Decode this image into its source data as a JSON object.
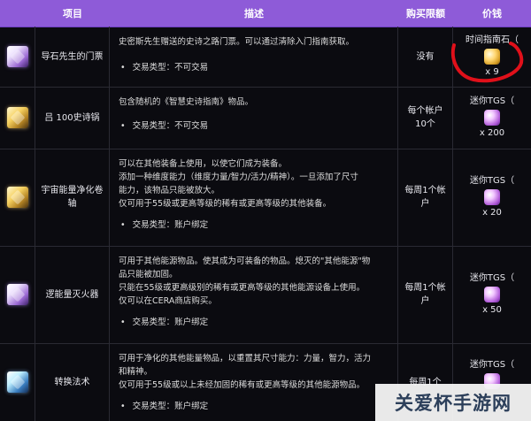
{
  "header": {
    "item": "项目",
    "description": "描述",
    "purchase_limit": "购买限额",
    "price": "价钱"
  },
  "rows": [
    {
      "icon": "magic-scroll-icon",
      "name": "导石先生的门票",
      "desc": [
        "史密斯先生赠送的史诗之路门票。可以通过清除入门指南获取。"
      ],
      "bullet": "交易类型：不可交易",
      "limit": "没有",
      "currency": "时间指南石（",
      "currency_icon": "time-guide-stone-icon",
      "qty": "x 9"
    },
    {
      "icon": "book-icon",
      "name": "吕 100史诗锅",
      "desc": [
        "包含随机的《智慧史诗指南》物品。"
      ],
      "bullet": "交易类型：不可交易",
      "limit": "每个帐户10个",
      "currency": "迷你TGS（",
      "currency_icon": "mini-tgs-icon",
      "qty": "x 200"
    },
    {
      "icon": "cosmic-scroll-icon",
      "name": "宇宙能量净化卷轴",
      "desc": [
        "可以在其他装备上使用，以使它们成为装备。",
        "添加一种维度能力（维度力量/智力/活力/精神）。一旦添加了尺寸",
        "能力，该物品只能被放大。",
        "仅可用于55级或更高等级的稀有或更高等级的其他装备。"
      ],
      "bullet": "交易类型：账户绑定",
      "limit": "每周1个帐户",
      "currency": "迷你TGS（",
      "currency_icon": "mini-tgs-icon",
      "qty": "x 20"
    },
    {
      "icon": "energy-extinguisher-icon",
      "name": "逻能量灭火器",
      "desc": [
        "可用于其他能源物品。使其成为可装备的物品。熄灭的\"其他能源\"物",
        "品只能被加固。",
        "只能在55级或更高级别的稀有或更高等级的其他能源设备上使用。",
        "仅可以在CERA商店购买。"
      ],
      "bullet": "交易类型：账户绑定",
      "limit": "每周1个帐户",
      "currency": "迷你TGS（",
      "currency_icon": "mini-tgs-icon",
      "qty": "x 50"
    },
    {
      "icon": "conversion-icon",
      "name": "转换法术",
      "desc": [
        "可用于净化的其他能量物品，以重置其尺寸能力：力量，智力，活力",
        "和精神。",
        "仅可用于55级或以上未经加固的稀有或更高等级的其他能源物品。"
      ],
      "bullet": "交易类型：账户绑定",
      "limit": "每周1个",
      "currency": "迷你TGS（",
      "currency_icon": "mini-tgs-icon",
      "qty": ""
    }
  ],
  "watermark": "关爱杯手游网",
  "colors": {
    "header": "#8e5bd8",
    "annotation": "#e0101a"
  }
}
